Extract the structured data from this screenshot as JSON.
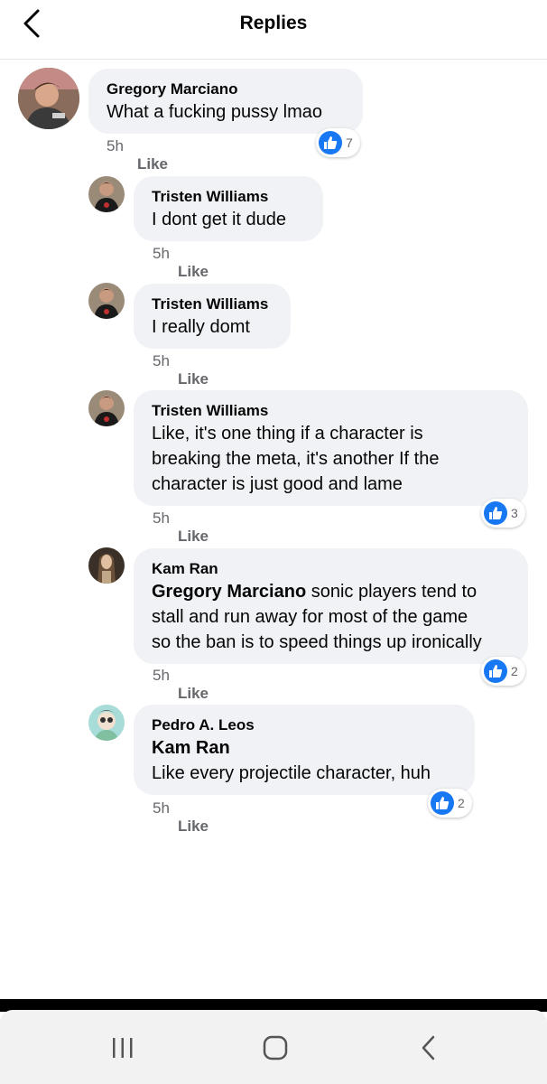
{
  "header": {
    "title": "Replies"
  },
  "colors": {
    "like_blue": "#1877f2",
    "bubble": "#f0f2f5",
    "meta_gray": "#65676b"
  },
  "comments": [
    {
      "author": "Gregory Marciano",
      "text": "What a fucking pussy lmao",
      "time": "5h",
      "like_label": "Like",
      "reaction_count": "7"
    },
    {
      "author": "Tristen Williams",
      "text": "I dont get it dude",
      "time": "5h",
      "like_label": "Like"
    },
    {
      "author": "Tristen Williams",
      "text": "I really domt",
      "time": "5h",
      "like_label": "Like"
    },
    {
      "author": "Tristen Williams",
      "lines": [
        "Like, it's one thing if a character is",
        "breaking the meta, it's another If the",
        "character is just good and lame"
      ],
      "time": "5h",
      "like_label": "Like",
      "reaction_count": "3"
    },
    {
      "author": "Kam Ran",
      "mention": "Gregory Marciano",
      "lines": [
        " sonic players tend to",
        "stall and run away for most of the game",
        "so the ban is to speed things up ironically"
      ],
      "time": "5h",
      "like_label": "Like",
      "reaction_count": "2"
    },
    {
      "author": "Pedro A. Leos",
      "mention": "Kam Ran",
      "text": "Like every projectile character, huh",
      "time": "5h",
      "like_label": "Like",
      "reaction_count": "2"
    }
  ],
  "navbar": {
    "icons": [
      "recent-apps-icon",
      "home-icon",
      "back-icon"
    ]
  }
}
